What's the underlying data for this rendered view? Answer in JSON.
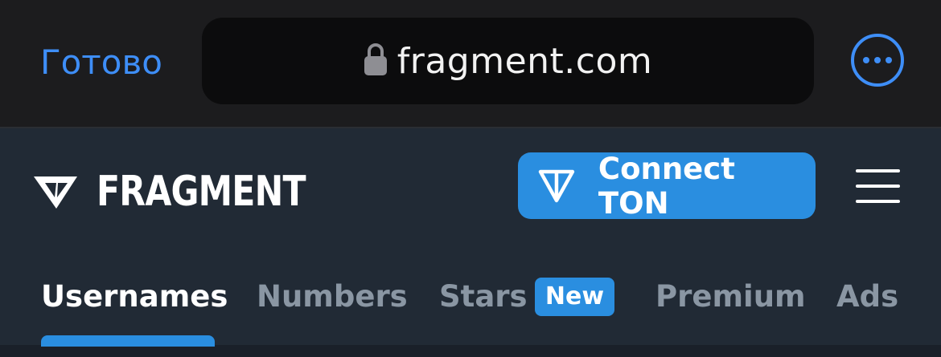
{
  "browser": {
    "done_label": "Готово",
    "url": "fragment.com",
    "lock_icon": "lock-icon",
    "more_icon": "ellipsis-circle-icon",
    "accent_color": "#3e8ef7"
  },
  "header": {
    "brand": "FRAGMENT",
    "logo_icon": "fragment-logo-icon",
    "connect_label": "Connect TON",
    "connect_icon": "ton-icon",
    "menu_icon": "hamburger-menu-icon",
    "button_color": "#2a8ee0"
  },
  "tabs": [
    {
      "label": "Usernames",
      "active": true
    },
    {
      "label": "Numbers",
      "active": false
    },
    {
      "label": "Stars",
      "active": false,
      "badge": "New"
    },
    {
      "label": "Premium",
      "active": false
    },
    {
      "label": "Ads",
      "active": false
    }
  ]
}
